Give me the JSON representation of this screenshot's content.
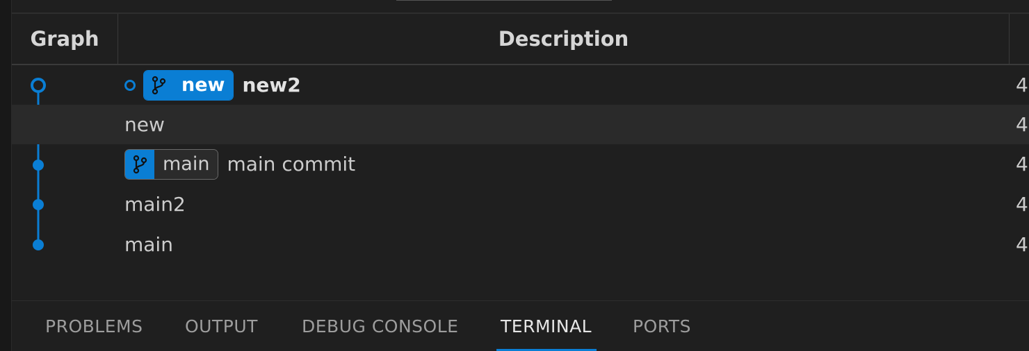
{
  "table": {
    "headers": {
      "graph": "Graph",
      "description": "Description"
    },
    "rows": [
      {
        "message": "new2",
        "ref": "new",
        "trail": "4"
      },
      {
        "message": "new",
        "trail": "4"
      },
      {
        "message": "main commit",
        "ref": "main",
        "trail": "4"
      },
      {
        "message": "main2",
        "trail": "4"
      },
      {
        "message": "main",
        "trail": "4"
      }
    ]
  },
  "panel": {
    "tabs": [
      "PROBLEMS",
      "OUTPUT",
      "DEBUG CONSOLE",
      "TERMINAL",
      "PORTS"
    ],
    "active_tab": "TERMINAL"
  },
  "colors": {
    "accent": "#0a7ed4",
    "background": "#1f1f1f",
    "selected_row": "#2a2a2a"
  },
  "icons": {
    "branch": "git-branch-icon",
    "head_commit": "hollow-commit-icon",
    "commit": "commit-dot-icon"
  }
}
